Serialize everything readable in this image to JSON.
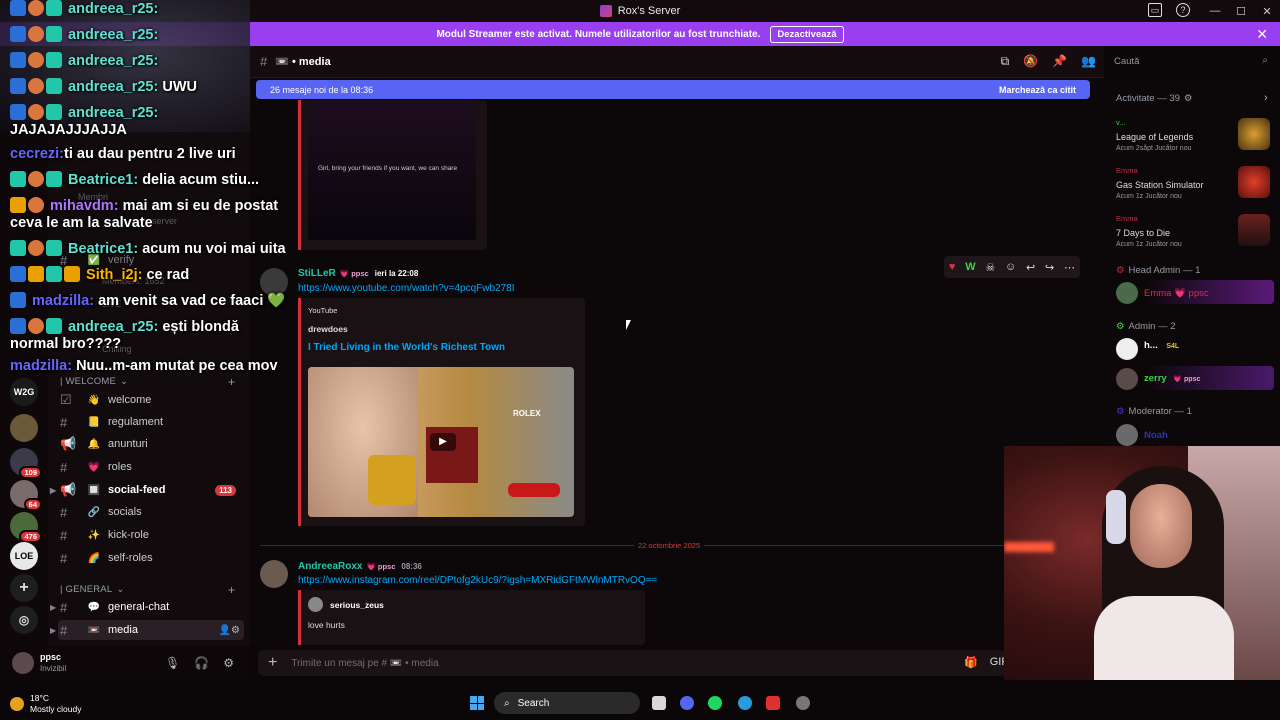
{
  "window": {
    "title": "Rox's Server",
    "controls": [
      "—",
      "☐",
      "✕"
    ]
  },
  "banner": {
    "text": "Modul Streamer este activat. Numele utilizatorilor au fost trunchiate.",
    "button": "Dezactivează",
    "close": "✕"
  },
  "rail": {
    "badges": [
      "109",
      "64",
      "476"
    ],
    "labels": [
      "W2G",
      "LOE"
    ]
  },
  "sidebar": {
    "category_welcome": "| WELCOME",
    "category_general": "| GENERAL",
    "channels": [
      {
        "emoji": "✅",
        "label": "verify"
      },
      {
        "emoji": "👋",
        "label": "welcome"
      },
      {
        "emoji": "📒",
        "label": "regulament"
      },
      {
        "emoji": "🔔",
        "label": "anunturi"
      },
      {
        "emoji": "💗",
        "label": "roles"
      },
      {
        "emoji": "🔲",
        "label": "social-feed",
        "badge": "113"
      },
      {
        "emoji": "🔗",
        "label": "socials"
      },
      {
        "emoji": "✨",
        "label": "kick-role"
      },
      {
        "emoji": "🌈",
        "label": "self-roles"
      },
      {
        "emoji": "💬",
        "label": "general-chat"
      },
      {
        "emoji": "📼",
        "label": "media"
      }
    ],
    "faded": [
      "Membri",
      "server",
      "Members: 1652",
      "LIVE",
      "Chilling"
    ]
  },
  "user_panel": {
    "name": "ppsc",
    "status": "Invizibil"
  },
  "overlay_chat": [
    {
      "user": "andreea_r25:",
      "text": ""
    },
    {
      "user": "andreea_r25:",
      "text": ""
    },
    {
      "user": "andreea_r25:",
      "text": ""
    },
    {
      "user": "andreea_r25:",
      "text": "UWU"
    },
    {
      "user": "andreea_r25:",
      "text": ""
    },
    {
      "user": "",
      "text": "JAJAJAJJJAJJA"
    },
    {
      "user": "cecrezi:",
      "text": "ti au dau pentru 2 live uri"
    },
    {
      "user": "Beatrice1:",
      "text": "delia acum stiu..."
    },
    {
      "user": "mihavdm:",
      "text": "mai am si eu de postat"
    },
    {
      "user": "",
      "text": "ceva le am la salvate"
    },
    {
      "user": "Beatrice1:",
      "text": "acum nu voi mai uita"
    },
    {
      "user": "Sith_i2j:",
      "text": "ce rad"
    },
    {
      "user": "madzilla:",
      "text": "am venit sa vad ce faaci 💚"
    },
    {
      "user": "andreea_r25:",
      "text": "ești blondă"
    },
    {
      "user": "",
      "text": "normal bro????"
    },
    {
      "user": "madzilla:",
      "text": "Nuu..m-am mutat pe cea mov"
    }
  ],
  "header": {
    "hash": "#",
    "channel": "📼 • media"
  },
  "search": {
    "placeholder": "Caută",
    "icon": "search-icon"
  },
  "new_messages": {
    "text": "26 mesaje noi de la 08:36",
    "mark": "Marchează ca citit"
  },
  "messages": {
    "video_caption": "Girl, bring your friends if you want, we can share",
    "msg1": {
      "user": "StiLLeR",
      "tag": "💗 ppsc",
      "time": "ieri la 22:08",
      "link": "https://www.youtube.com/watch?v=4pcqFwb278I",
      "provider": "YouTube",
      "author": "drewdoes",
      "title": "I Tried Living in the World's Richest Town",
      "thumb_text": "ROLEX"
    },
    "date_divider": "22 octombrie 2025",
    "msg2": {
      "user": "AndreeaRoxx",
      "tag": "💗 ppsc",
      "time": "08:36",
      "link": "https://www.instagram.com/reel/DPtofg2kUc9/?igsh=MXRidGFtMWlnMTRvOQ==",
      "embed_user": "serious_zeus",
      "embed_text": "love hurts"
    }
  },
  "composer": {
    "placeholder": "Trimite un mesaj pe # 📼 • media"
  },
  "members": {
    "activity": "Activitate — 39",
    "activities": [
      {
        "user": "v...",
        "game": "League of Legends",
        "meta": "Acum 2săpt  Jucător nou"
      },
      {
        "user": "Emma",
        "game": "Gas Station Simulator",
        "meta": "Acum 1z  Jucător nou"
      },
      {
        "user": "Emma",
        "game": "7 Days to Die",
        "meta": "Acum 1z  Jucător nou"
      }
    ],
    "head_admin": "Head Admin — 1",
    "head_admin_member": "Emma 💗 ppsc",
    "admin": "Admin — 2",
    "admin_members": [
      {
        "name": "h...",
        "tag": "S4L"
      },
      {
        "name": "zerry",
        "tag": "💗 ppsc"
      }
    ],
    "moderator": "Moderator — 1",
    "moderator_member": "Noah"
  },
  "taskbar": {
    "temp": "18°C",
    "weather": "Mostly cloudy",
    "search": "Search"
  },
  "colors": {
    "accent": "#9a3ff0",
    "blurple": "#5865f2",
    "red_divider": "#d32f3a"
  }
}
